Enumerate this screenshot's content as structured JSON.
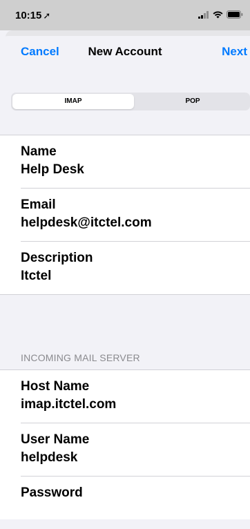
{
  "status_bar": {
    "time": "10:15",
    "location_glyph": "➚"
  },
  "nav": {
    "cancel_label": "Cancel",
    "title": "New Account",
    "next_label": "Next"
  },
  "segmented": {
    "options": [
      "IMAP",
      "POP"
    ],
    "selected": "IMAP"
  },
  "account": {
    "name_label": "Name",
    "name_value": "Help Desk",
    "email_label": "Email",
    "email_value": "helpdesk@itctel.com",
    "description_label": "Description",
    "description_value": "Itctel"
  },
  "incoming": {
    "header": "INCOMING MAIL SERVER",
    "host_label": "Host Name",
    "host_value": "imap.itctel.com",
    "user_label": "User Name",
    "user_value": "helpdesk",
    "password_label": "Password"
  },
  "colors": {
    "accent": "#007aff",
    "background": "#f2f2f7",
    "status_bar": "#cfcfcf"
  },
  "icons": [
    "location-arrow-icon",
    "cellular-signal-icon",
    "wifi-icon",
    "battery-icon"
  ]
}
